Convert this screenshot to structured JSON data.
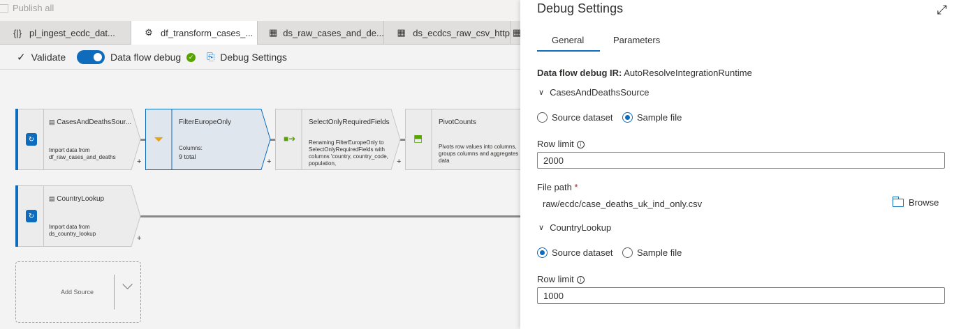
{
  "top": {
    "publish_all": "Publish all"
  },
  "tabs": [
    {
      "label": "pl_ingest_ecdc_dat...",
      "icon": "pipeline-icon"
    },
    {
      "label": "df_transform_cases_...",
      "icon": "dataflow-icon"
    },
    {
      "label": "ds_raw_cases_and_de...",
      "icon": "table-icon"
    },
    {
      "label": "ds_ecdcs_raw_csv_http",
      "icon": "table-icon"
    }
  ],
  "toolbar": {
    "validate": "Validate",
    "dataflow_debug": "Data flow debug",
    "debug_settings": "Debug Settings"
  },
  "canvas": {
    "nodes": {
      "cases_source": {
        "title": "CasesAndDeathsSour...",
        "desc": "Import data from df_raw_cases_and_deaths"
      },
      "filter": {
        "title": "FilterEuropeOnly",
        "desc": "Columns:",
        "count": "9 total"
      },
      "select": {
        "title": "SelectOnlyRequiredFields",
        "desc": "Renaming FilterEuropeOnly to SelectOnlyRequiredFields with columns 'country, country_code, population,"
      },
      "pivot": {
        "title": "PivotCounts",
        "desc": "Pivots row values into columns, groups columns and aggregates data"
      },
      "country_lookup": {
        "title": "CountryLookup",
        "desc": "Import data from ds_country_lookup"
      }
    },
    "plus": "+",
    "add_source": "Add Source"
  },
  "panel": {
    "title": "Debug Settings",
    "tabs": {
      "general": "General",
      "parameters": "Parameters"
    },
    "ir_label": "Data flow debug IR:",
    "ir_value": "AutoResolveIntegrationRuntime",
    "section1": {
      "name": "CasesAndDeathsSource",
      "source_dataset": "Source dataset",
      "sample_file": "Sample file",
      "row_limit_label": "Row limit",
      "row_limit_value": "2000",
      "file_path_label": "File path",
      "required_mark": "*",
      "file_path_value": "raw/ecdc/case_deaths_uk_ind_only.csv",
      "browse": "Browse"
    },
    "section2": {
      "name": "CountryLookup",
      "source_dataset": "Source dataset",
      "sample_file": "Sample file",
      "row_limit_label": "Row limit",
      "row_limit_value": "1000"
    }
  },
  "colors": {
    "accent": "#0f6cbd",
    "success": "#57a300",
    "required": "#a4262c"
  }
}
